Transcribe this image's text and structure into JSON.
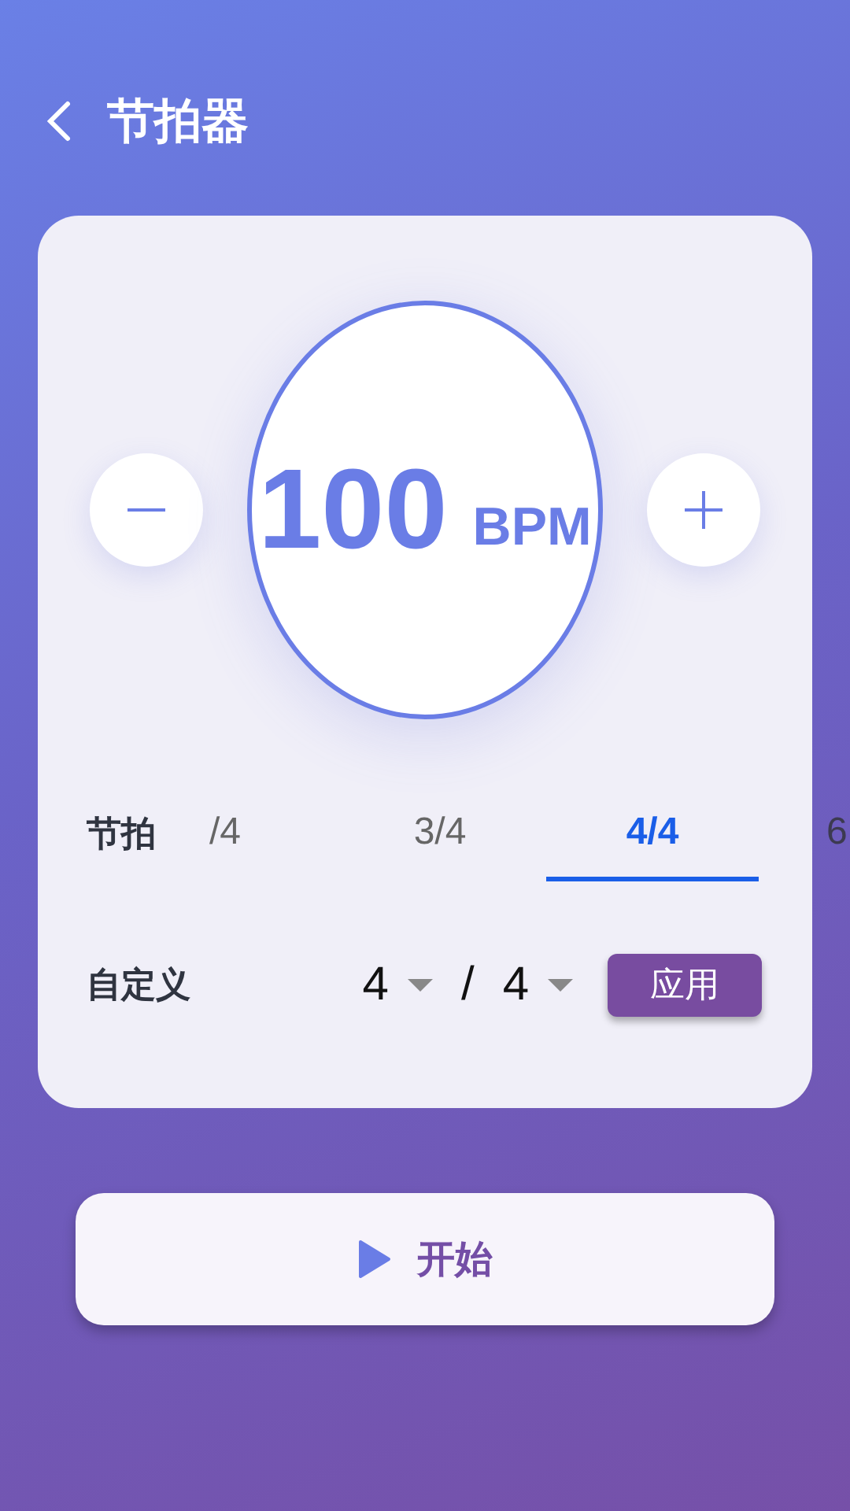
{
  "header": {
    "title": "节拍器"
  },
  "tempo": {
    "value": "100",
    "unit": "BPM"
  },
  "meter": {
    "label": "节拍",
    "tabs": [
      {
        "label": "/4",
        "selected": false
      },
      {
        "label": "3/4",
        "selected": false
      },
      {
        "label": "4/4",
        "selected": true
      },
      {
        "label": "6",
        "selected": false
      }
    ]
  },
  "custom": {
    "label": "自定义",
    "numerator": "4",
    "separator": "/",
    "denominator": "4",
    "apply_button": "应用"
  },
  "start_button": {
    "label": "开始"
  }
}
